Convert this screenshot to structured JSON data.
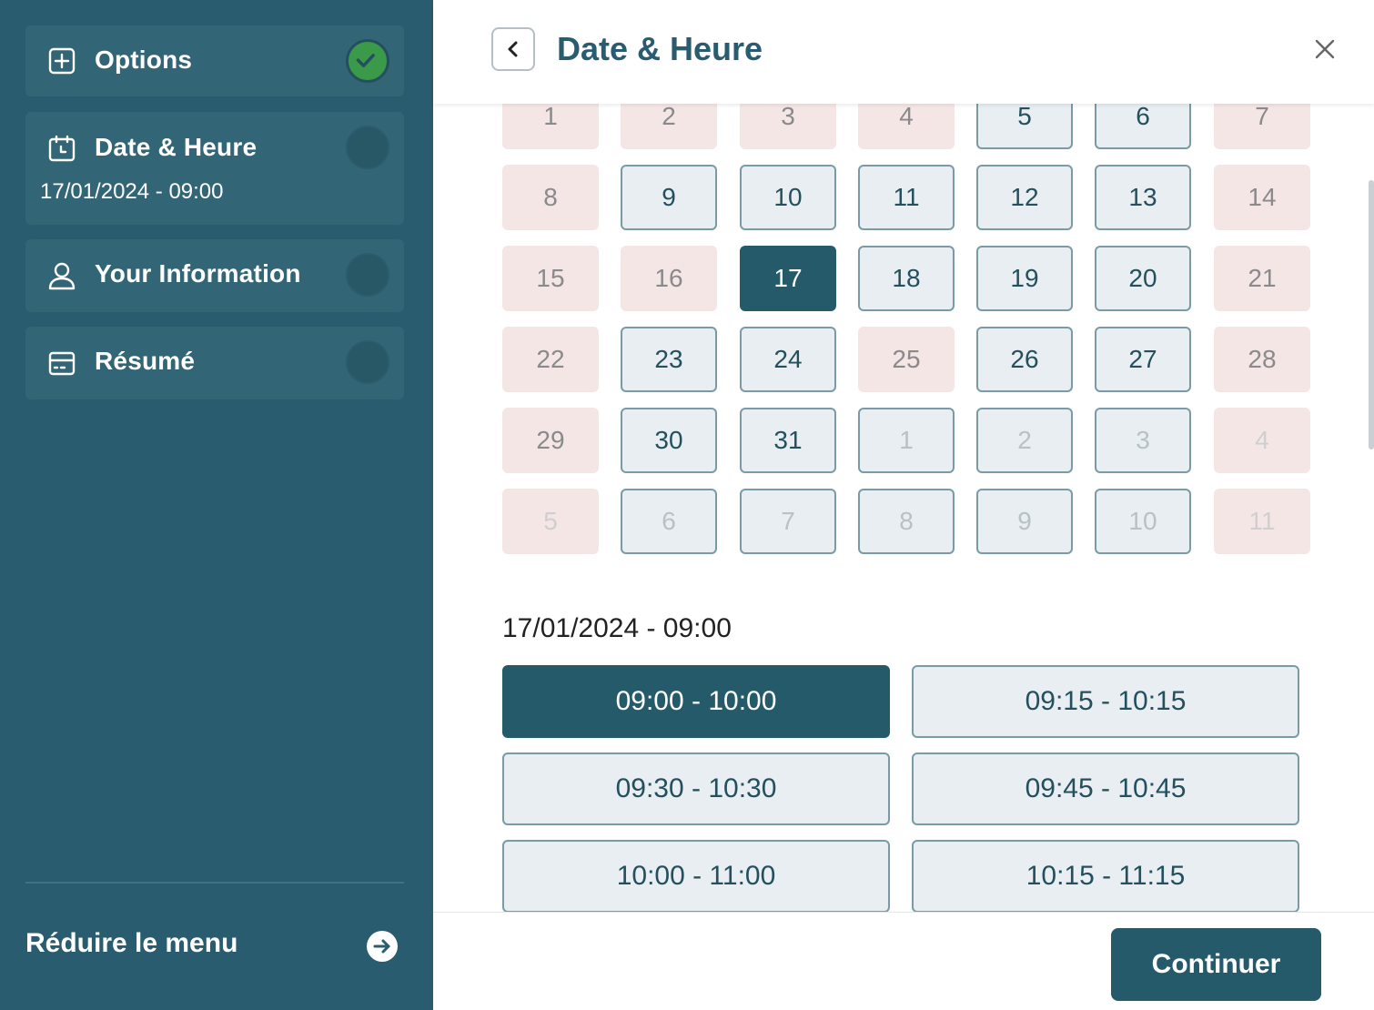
{
  "sidebar": {
    "steps": [
      {
        "title": "Options",
        "icon": "plus-square-icon",
        "status": "done"
      },
      {
        "title": "Date & Heure",
        "icon": "calendar-icon",
        "status": "current",
        "subtitle": "17/01/2024 - 09:00"
      },
      {
        "title": "Your Information",
        "icon": "user-icon",
        "status": "pending"
      },
      {
        "title": "Résumé",
        "icon": "credit-card-icon",
        "status": "pending"
      }
    ],
    "collapse_label": "Réduire le menu"
  },
  "header": {
    "title": "Date & Heure"
  },
  "calendar": {
    "selected_day": "17",
    "weeks": [
      [
        {
          "d": "1",
          "s": "closed"
        },
        {
          "d": "2",
          "s": "closed"
        },
        {
          "d": "3",
          "s": "closed"
        },
        {
          "d": "4",
          "s": "closed"
        },
        {
          "d": "5",
          "s": "open"
        },
        {
          "d": "6",
          "s": "open"
        },
        {
          "d": "7",
          "s": "closed"
        }
      ],
      [
        {
          "d": "8",
          "s": "closed"
        },
        {
          "d": "9",
          "s": "open"
        },
        {
          "d": "10",
          "s": "open"
        },
        {
          "d": "11",
          "s": "open"
        },
        {
          "d": "12",
          "s": "open"
        },
        {
          "d": "13",
          "s": "open"
        },
        {
          "d": "14",
          "s": "closed"
        }
      ],
      [
        {
          "d": "15",
          "s": "closed"
        },
        {
          "d": "16",
          "s": "closed"
        },
        {
          "d": "17",
          "s": "selected"
        },
        {
          "d": "18",
          "s": "open"
        },
        {
          "d": "19",
          "s": "open"
        },
        {
          "d": "20",
          "s": "open"
        },
        {
          "d": "21",
          "s": "closed"
        }
      ],
      [
        {
          "d": "22",
          "s": "closed"
        },
        {
          "d": "23",
          "s": "open"
        },
        {
          "d": "24",
          "s": "open"
        },
        {
          "d": "25",
          "s": "closed"
        },
        {
          "d": "26",
          "s": "open"
        },
        {
          "d": "27",
          "s": "open"
        },
        {
          "d": "28",
          "s": "closed"
        }
      ],
      [
        {
          "d": "29",
          "s": "closed"
        },
        {
          "d": "30",
          "s": "open"
        },
        {
          "d": "31",
          "s": "open"
        },
        {
          "d": "1",
          "s": "open-faded"
        },
        {
          "d": "2",
          "s": "open-faded"
        },
        {
          "d": "3",
          "s": "open-faded"
        },
        {
          "d": "4",
          "s": "closed-faded"
        }
      ],
      [
        {
          "d": "5",
          "s": "closed-faded"
        },
        {
          "d": "6",
          "s": "open-faded"
        },
        {
          "d": "7",
          "s": "open-faded"
        },
        {
          "d": "8",
          "s": "open-faded"
        },
        {
          "d": "9",
          "s": "open-faded"
        },
        {
          "d": "10",
          "s": "open-faded"
        },
        {
          "d": "11",
          "s": "closed-faded"
        }
      ]
    ]
  },
  "slots": {
    "label": "17/01/2024 - 09:00",
    "items": [
      {
        "label": "09:00 - 10:00",
        "selected": true
      },
      {
        "label": "09:15 - 10:15",
        "selected": false
      },
      {
        "label": "09:30 - 10:30",
        "selected": false
      },
      {
        "label": "09:45 - 10:45",
        "selected": false
      },
      {
        "label": "10:00 - 11:00",
        "selected": false
      },
      {
        "label": "10:15 - 11:15",
        "selected": false
      }
    ]
  },
  "footer": {
    "continue_label": "Continuer"
  },
  "colors": {
    "primary": "#2a5c6f",
    "selected": "#255a6b",
    "done": "#3a9a4a",
    "closed_bg": "#f5e6e6",
    "open_bg": "#e8eef1"
  }
}
